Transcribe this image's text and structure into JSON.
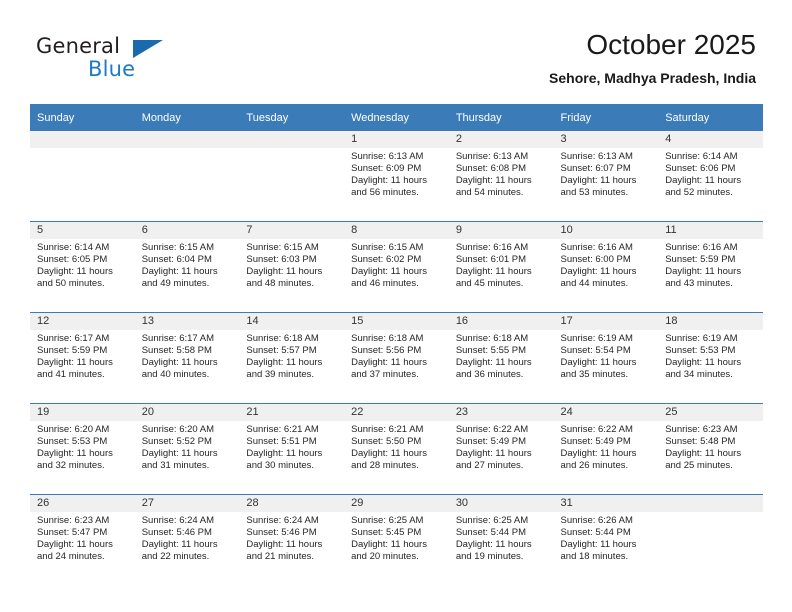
{
  "brand": {
    "name_part1": "General",
    "name_part2": "Blue",
    "triangle_icon": "blue-triangle-icon",
    "colors": {
      "general": "#231f20",
      "blue": "#1f7ac4",
      "triangle": "#1b6ab0"
    }
  },
  "header": {
    "title": "October 2025",
    "subtitle": "Sehore, Madhya Pradesh, India"
  },
  "theme": {
    "header_row_bg": "#3b7cb8",
    "header_row_text": "#ffffff",
    "daynum_band_bg": "#f0f0f0",
    "grid_line": "#3b7cb8",
    "cell_bg": "#ffffff",
    "body_text": "#262626"
  },
  "calendar": {
    "weekday_headers": [
      "Sunday",
      "Monday",
      "Tuesday",
      "Wednesday",
      "Thursday",
      "Friday",
      "Saturday"
    ],
    "weeks": [
      [
        {
          "day": "",
          "blank": true,
          "sunrise": "",
          "sunset": "",
          "daylight_line1": "",
          "daylight_line2": ""
        },
        {
          "day": "",
          "blank": true,
          "sunrise": "",
          "sunset": "",
          "daylight_line1": "",
          "daylight_line2": ""
        },
        {
          "day": "",
          "blank": true,
          "sunrise": "",
          "sunset": "",
          "daylight_line1": "",
          "daylight_line2": ""
        },
        {
          "day": "1",
          "blank": false,
          "sunrise": "Sunrise: 6:13 AM",
          "sunset": "Sunset: 6:09 PM",
          "daylight_line1": "Daylight: 11 hours",
          "daylight_line2": "and 56 minutes."
        },
        {
          "day": "2",
          "blank": false,
          "sunrise": "Sunrise: 6:13 AM",
          "sunset": "Sunset: 6:08 PM",
          "daylight_line1": "Daylight: 11 hours",
          "daylight_line2": "and 54 minutes."
        },
        {
          "day": "3",
          "blank": false,
          "sunrise": "Sunrise: 6:13 AM",
          "sunset": "Sunset: 6:07 PM",
          "daylight_line1": "Daylight: 11 hours",
          "daylight_line2": "and 53 minutes."
        },
        {
          "day": "4",
          "blank": false,
          "sunrise": "Sunrise: 6:14 AM",
          "sunset": "Sunset: 6:06 PM",
          "daylight_line1": "Daylight: 11 hours",
          "daylight_line2": "and 52 minutes."
        }
      ],
      [
        {
          "day": "5",
          "blank": false,
          "sunrise": "Sunrise: 6:14 AM",
          "sunset": "Sunset: 6:05 PM",
          "daylight_line1": "Daylight: 11 hours",
          "daylight_line2": "and 50 minutes."
        },
        {
          "day": "6",
          "blank": false,
          "sunrise": "Sunrise: 6:15 AM",
          "sunset": "Sunset: 6:04 PM",
          "daylight_line1": "Daylight: 11 hours",
          "daylight_line2": "and 49 minutes."
        },
        {
          "day": "7",
          "blank": false,
          "sunrise": "Sunrise: 6:15 AM",
          "sunset": "Sunset: 6:03 PM",
          "daylight_line1": "Daylight: 11 hours",
          "daylight_line2": "and 48 minutes."
        },
        {
          "day": "8",
          "blank": false,
          "sunrise": "Sunrise: 6:15 AM",
          "sunset": "Sunset: 6:02 PM",
          "daylight_line1": "Daylight: 11 hours",
          "daylight_line2": "and 46 minutes."
        },
        {
          "day": "9",
          "blank": false,
          "sunrise": "Sunrise: 6:16 AM",
          "sunset": "Sunset: 6:01 PM",
          "daylight_line1": "Daylight: 11 hours",
          "daylight_line2": "and 45 minutes."
        },
        {
          "day": "10",
          "blank": false,
          "sunrise": "Sunrise: 6:16 AM",
          "sunset": "Sunset: 6:00 PM",
          "daylight_line1": "Daylight: 11 hours",
          "daylight_line2": "and 44 minutes."
        },
        {
          "day": "11",
          "blank": false,
          "sunrise": "Sunrise: 6:16 AM",
          "sunset": "Sunset: 5:59 PM",
          "daylight_line1": "Daylight: 11 hours",
          "daylight_line2": "and 43 minutes."
        }
      ],
      [
        {
          "day": "12",
          "blank": false,
          "sunrise": "Sunrise: 6:17 AM",
          "sunset": "Sunset: 5:59 PM",
          "daylight_line1": "Daylight: 11 hours",
          "daylight_line2": "and 41 minutes."
        },
        {
          "day": "13",
          "blank": false,
          "sunrise": "Sunrise: 6:17 AM",
          "sunset": "Sunset: 5:58 PM",
          "daylight_line1": "Daylight: 11 hours",
          "daylight_line2": "and 40 minutes."
        },
        {
          "day": "14",
          "blank": false,
          "sunrise": "Sunrise: 6:18 AM",
          "sunset": "Sunset: 5:57 PM",
          "daylight_line1": "Daylight: 11 hours",
          "daylight_line2": "and 39 minutes."
        },
        {
          "day": "15",
          "blank": false,
          "sunrise": "Sunrise: 6:18 AM",
          "sunset": "Sunset: 5:56 PM",
          "daylight_line1": "Daylight: 11 hours",
          "daylight_line2": "and 37 minutes."
        },
        {
          "day": "16",
          "blank": false,
          "sunrise": "Sunrise: 6:18 AM",
          "sunset": "Sunset: 5:55 PM",
          "daylight_line1": "Daylight: 11 hours",
          "daylight_line2": "and 36 minutes."
        },
        {
          "day": "17",
          "blank": false,
          "sunrise": "Sunrise: 6:19 AM",
          "sunset": "Sunset: 5:54 PM",
          "daylight_line1": "Daylight: 11 hours",
          "daylight_line2": "and 35 minutes."
        },
        {
          "day": "18",
          "blank": false,
          "sunrise": "Sunrise: 6:19 AM",
          "sunset": "Sunset: 5:53 PM",
          "daylight_line1": "Daylight: 11 hours",
          "daylight_line2": "and 34 minutes."
        }
      ],
      [
        {
          "day": "19",
          "blank": false,
          "sunrise": "Sunrise: 6:20 AM",
          "sunset": "Sunset: 5:53 PM",
          "daylight_line1": "Daylight: 11 hours",
          "daylight_line2": "and 32 minutes."
        },
        {
          "day": "20",
          "blank": false,
          "sunrise": "Sunrise: 6:20 AM",
          "sunset": "Sunset: 5:52 PM",
          "daylight_line1": "Daylight: 11 hours",
          "daylight_line2": "and 31 minutes."
        },
        {
          "day": "21",
          "blank": false,
          "sunrise": "Sunrise: 6:21 AM",
          "sunset": "Sunset: 5:51 PM",
          "daylight_line1": "Daylight: 11 hours",
          "daylight_line2": "and 30 minutes."
        },
        {
          "day": "22",
          "blank": false,
          "sunrise": "Sunrise: 6:21 AM",
          "sunset": "Sunset: 5:50 PM",
          "daylight_line1": "Daylight: 11 hours",
          "daylight_line2": "and 28 minutes."
        },
        {
          "day": "23",
          "blank": false,
          "sunrise": "Sunrise: 6:22 AM",
          "sunset": "Sunset: 5:49 PM",
          "daylight_line1": "Daylight: 11 hours",
          "daylight_line2": "and 27 minutes."
        },
        {
          "day": "24",
          "blank": false,
          "sunrise": "Sunrise: 6:22 AM",
          "sunset": "Sunset: 5:49 PM",
          "daylight_line1": "Daylight: 11 hours",
          "daylight_line2": "and 26 minutes."
        },
        {
          "day": "25",
          "blank": false,
          "sunrise": "Sunrise: 6:23 AM",
          "sunset": "Sunset: 5:48 PM",
          "daylight_line1": "Daylight: 11 hours",
          "daylight_line2": "and 25 minutes."
        }
      ],
      [
        {
          "day": "26",
          "blank": false,
          "sunrise": "Sunrise: 6:23 AM",
          "sunset": "Sunset: 5:47 PM",
          "daylight_line1": "Daylight: 11 hours",
          "daylight_line2": "and 24 minutes."
        },
        {
          "day": "27",
          "blank": false,
          "sunrise": "Sunrise: 6:24 AM",
          "sunset": "Sunset: 5:46 PM",
          "daylight_line1": "Daylight: 11 hours",
          "daylight_line2": "and 22 minutes."
        },
        {
          "day": "28",
          "blank": false,
          "sunrise": "Sunrise: 6:24 AM",
          "sunset": "Sunset: 5:46 PM",
          "daylight_line1": "Daylight: 11 hours",
          "daylight_line2": "and 21 minutes."
        },
        {
          "day": "29",
          "blank": false,
          "sunrise": "Sunrise: 6:25 AM",
          "sunset": "Sunset: 5:45 PM",
          "daylight_line1": "Daylight: 11 hours",
          "daylight_line2": "and 20 minutes."
        },
        {
          "day": "30",
          "blank": false,
          "sunrise": "Sunrise: 6:25 AM",
          "sunset": "Sunset: 5:44 PM",
          "daylight_line1": "Daylight: 11 hours",
          "daylight_line2": "and 19 minutes."
        },
        {
          "day": "31",
          "blank": false,
          "sunrise": "Sunrise: 6:26 AM",
          "sunset": "Sunset: 5:44 PM",
          "daylight_line1": "Daylight: 11 hours",
          "daylight_line2": "and 18 minutes."
        },
        {
          "day": "",
          "blank": true,
          "sunrise": "",
          "sunset": "",
          "daylight_line1": "",
          "daylight_line2": ""
        }
      ]
    ]
  }
}
